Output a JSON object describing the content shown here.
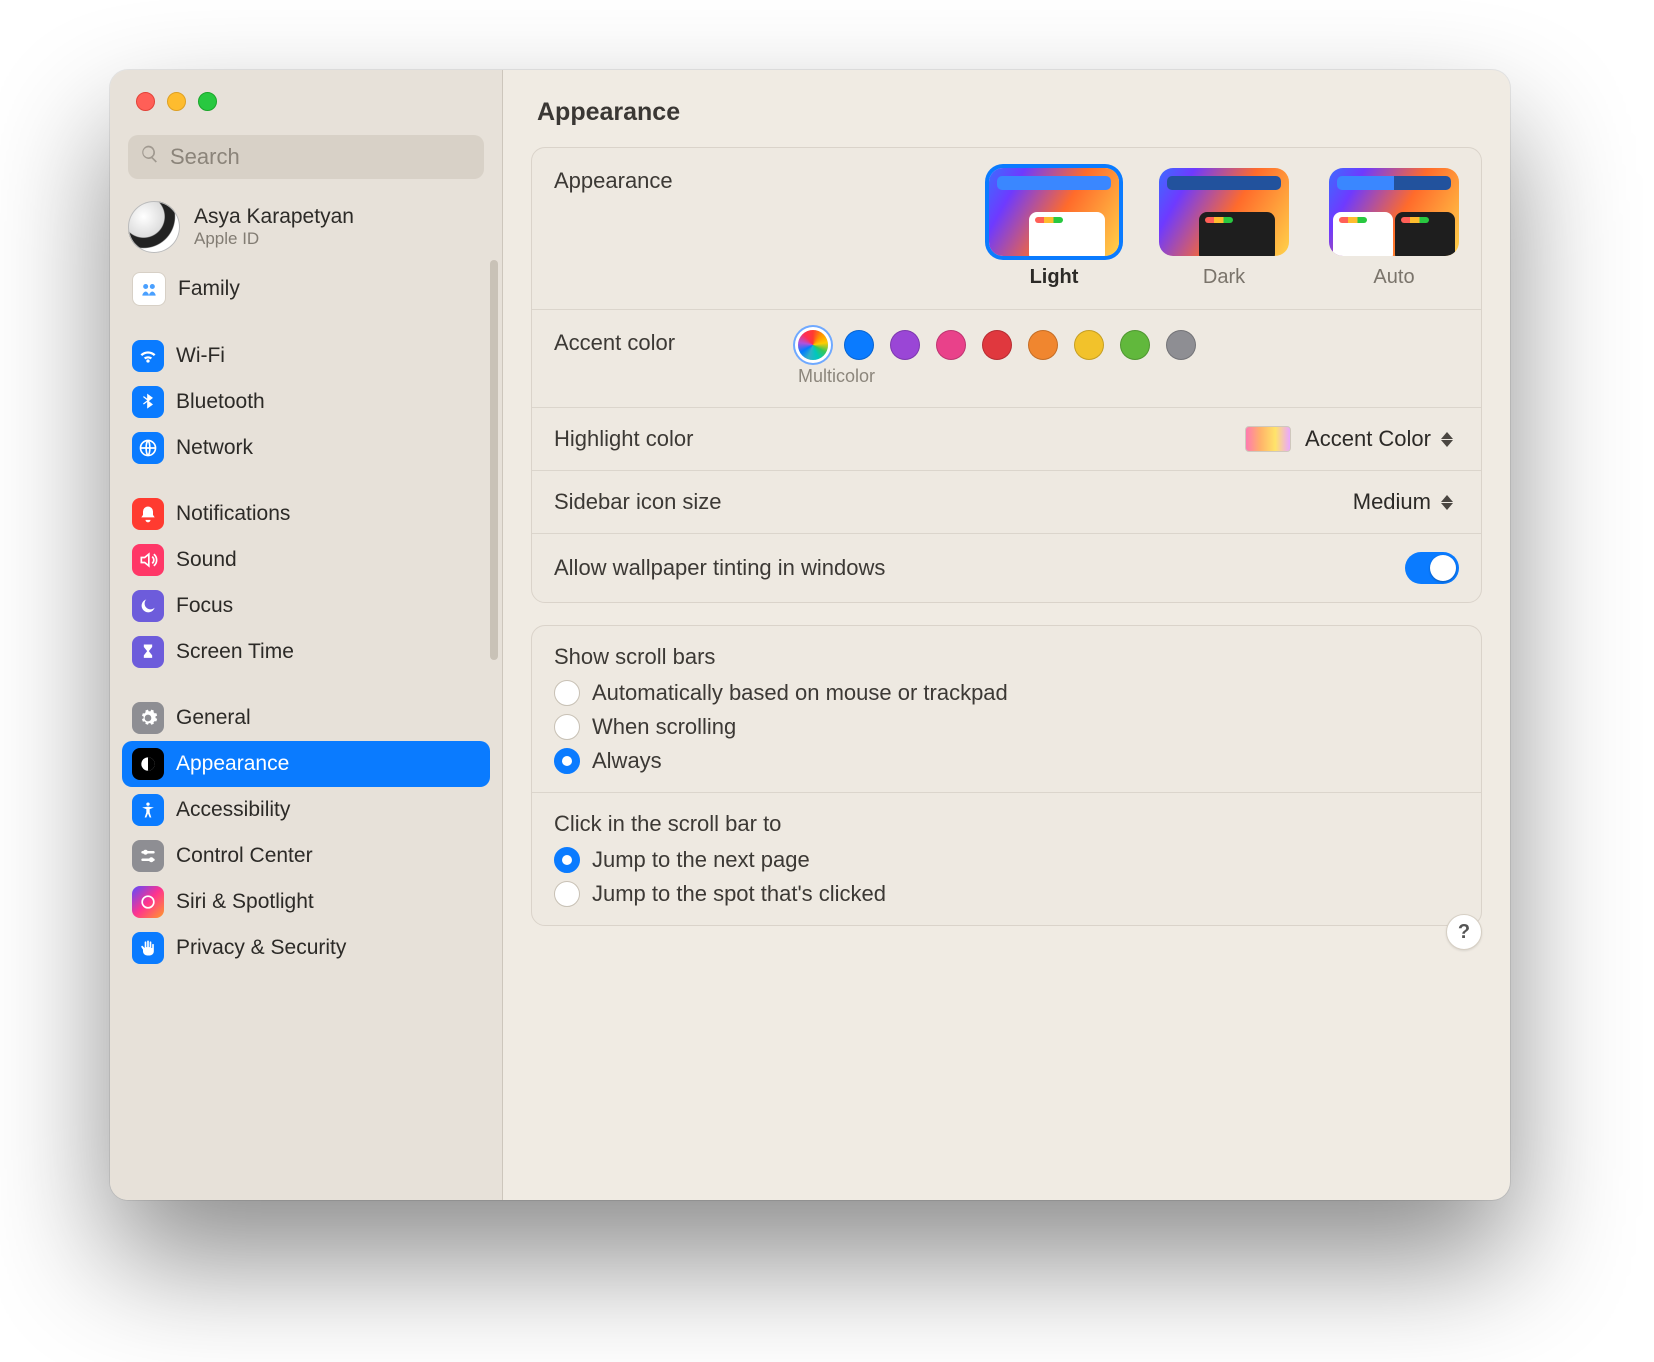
{
  "window": {
    "title": "Appearance"
  },
  "search": {
    "placeholder": "Search"
  },
  "account": {
    "name": "Asya Karapetyan",
    "sub": "Apple ID"
  },
  "sidebar": {
    "items": [
      {
        "label": "Family"
      },
      {
        "label": "Wi-Fi"
      },
      {
        "label": "Bluetooth"
      },
      {
        "label": "Network"
      },
      {
        "label": "Notifications"
      },
      {
        "label": "Sound"
      },
      {
        "label": "Focus"
      },
      {
        "label": "Screen Time"
      },
      {
        "label": "General"
      },
      {
        "label": "Appearance"
      },
      {
        "label": "Accessibility"
      },
      {
        "label": "Control Center"
      },
      {
        "label": "Siri & Spotlight"
      },
      {
        "label": "Privacy & Security"
      }
    ]
  },
  "appearance": {
    "section_label": "Appearance",
    "options": {
      "light": "Light",
      "dark": "Dark",
      "auto": "Auto"
    },
    "selected": "Light"
  },
  "accent": {
    "section_label": "Accent color",
    "caption": "Multicolor",
    "colors": {
      "multicolor": "multi",
      "blue": "#0A7BFF",
      "purple": "#9A46D6",
      "pink": "#E9418A",
      "red": "#E0383E",
      "orange": "#F0862F",
      "yellow": "#F2C22B",
      "green": "#61B83C",
      "graphite": "#8E8E93"
    },
    "selected": "multicolor"
  },
  "highlight": {
    "section_label": "Highlight color",
    "value": "Accent Color"
  },
  "sidebar_icon": {
    "section_label": "Sidebar icon size",
    "value": "Medium"
  },
  "tinting": {
    "section_label": "Allow wallpaper tinting in windows",
    "on": true
  },
  "scrollbars": {
    "title": "Show scroll bars",
    "options": {
      "auto": "Automatically based on mouse or trackpad",
      "scroll": "When scrolling",
      "always": "Always"
    },
    "selected": "always"
  },
  "click_scroll": {
    "title": "Click in the scroll bar to",
    "options": {
      "page": "Jump to the next page",
      "spot": "Jump to the spot that's clicked"
    },
    "selected": "page"
  },
  "help": {
    "label": "?"
  }
}
